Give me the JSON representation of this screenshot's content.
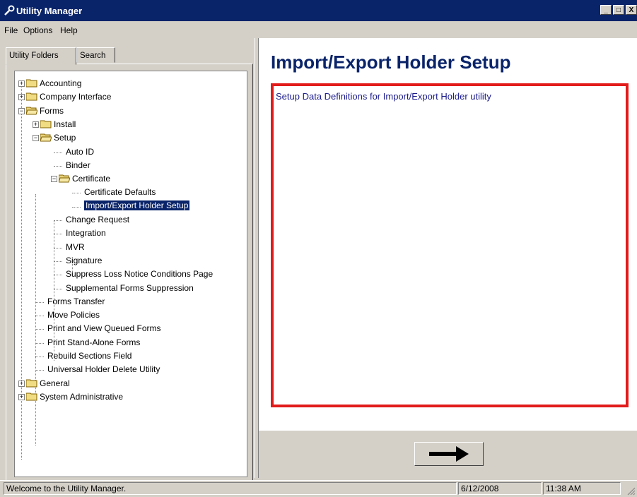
{
  "window": {
    "title": "Utility Manager",
    "controls": {
      "minimize": "_",
      "maximize": "□",
      "close": "X"
    }
  },
  "menu": {
    "file": "File",
    "options": "Options",
    "help": "Help"
  },
  "tabs": {
    "folders": "Utility Folders",
    "search": "Search"
  },
  "tree": [
    {
      "label": "Accounting",
      "level": 0,
      "type": "folder",
      "state": "collapsed"
    },
    {
      "label": "Company Interface",
      "level": 0,
      "type": "folder",
      "state": "collapsed"
    },
    {
      "label": "Forms",
      "level": 0,
      "type": "folder",
      "state": "expanded"
    },
    {
      "label": "Install",
      "level": 1,
      "type": "folder",
      "state": "collapsed"
    },
    {
      "label": "Setup",
      "level": 1,
      "type": "folder",
      "state": "expanded"
    },
    {
      "label": "Auto ID",
      "level": 2,
      "type": "leaf"
    },
    {
      "label": "Binder",
      "level": 2,
      "type": "leaf"
    },
    {
      "label": "Certificate",
      "level": 2,
      "type": "folder",
      "state": "expanded"
    },
    {
      "label": "Certificate Defaults",
      "level": 3,
      "type": "leaf"
    },
    {
      "label": "Import/Export Holder Setup",
      "level": 3,
      "type": "leaf",
      "selected": true
    },
    {
      "label": "Change Request",
      "level": 2,
      "type": "leaf"
    },
    {
      "label": "Integration",
      "level": 2,
      "type": "leaf"
    },
    {
      "label": "MVR",
      "level": 2,
      "type": "leaf"
    },
    {
      "label": "Signature",
      "level": 2,
      "type": "leaf"
    },
    {
      "label": "Suppress Loss Notice Conditions Page",
      "level": 2,
      "type": "leaf"
    },
    {
      "label": "Supplemental Forms Suppression",
      "level": 2,
      "type": "leaf"
    },
    {
      "label": "Forms Transfer",
      "level": 1,
      "type": "leaf"
    },
    {
      "label": "Move Policies",
      "level": 1,
      "type": "leaf"
    },
    {
      "label": "Print and View Queued Forms",
      "level": 1,
      "type": "leaf"
    },
    {
      "label": "Print Stand-Alone Forms",
      "level": 1,
      "type": "leaf"
    },
    {
      "label": "Rebuild Sections Field",
      "level": 1,
      "type": "leaf"
    },
    {
      "label": "Universal Holder Delete Utility",
      "level": 1,
      "type": "leaf"
    },
    {
      "label": "General",
      "level": 0,
      "type": "folder",
      "state": "collapsed"
    },
    {
      "label": "System Administrative",
      "level": 0,
      "type": "folder",
      "state": "collapsed"
    }
  ],
  "main": {
    "title": "Import/Export Holder Setup",
    "description": "Setup Data Definitions for Import/Export Holder utility",
    "accent_color": "#e21b1b",
    "go_button_icon": "right-arrow-icon"
  },
  "status": {
    "message": "Welcome to the Utility Manager.",
    "date": "6/12/2008",
    "time": "11:38 AM"
  }
}
